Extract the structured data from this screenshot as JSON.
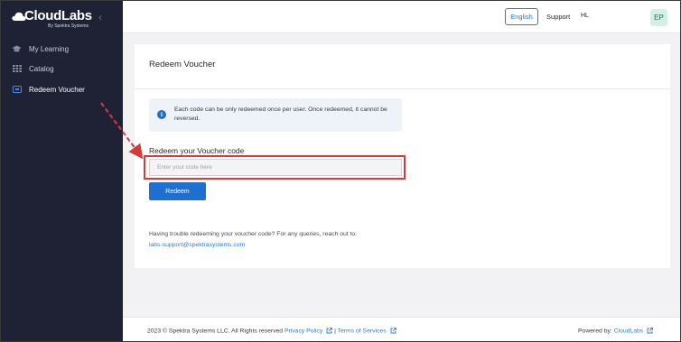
{
  "sidebar": {
    "logo_text": "CloudLabs",
    "logo_subtext": "By Spektra Systems",
    "collapse_icon": "chevron-left-icon",
    "items": [
      {
        "label": "My Learning",
        "icon": "graduation-cap-icon",
        "active": false
      },
      {
        "label": "Catalog",
        "icon": "grid-icon",
        "active": false
      },
      {
        "label": "Redeem Voucher",
        "icon": "voucher-icon",
        "active": true
      }
    ]
  },
  "topbar": {
    "language": "English",
    "support": "Support",
    "user_partial": "HL",
    "avatar_initials": "EP"
  },
  "main": {
    "title": "Redeem Voucher",
    "info": "Each code can be only redeemed once per user. Once redeemed, it cannot be reversed.",
    "field_label": "Redeem your Voucher code",
    "input_placeholder": "Enter your code here",
    "input_value": "",
    "redeem_label": "Redeem",
    "help_text": "Having trouble redeeming your voucher code? For any queries, reach out to:",
    "help_email": "labs-support@spektrasystems.com"
  },
  "footer": {
    "copyright": "2023 © Spektra Systems LLC. All Rights reserved",
    "privacy": "Privacy Policy",
    "separator": "|",
    "terms": "Terms of Services",
    "powered_label": "Powered by:",
    "powered_brand": "CloudLabs"
  },
  "colors": {
    "sidebar_bg": "#1f2235",
    "accent": "#1f6fd1",
    "highlight": "#d33c3c"
  }
}
